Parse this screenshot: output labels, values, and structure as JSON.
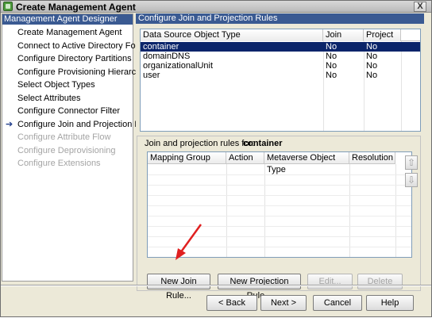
{
  "window": {
    "title": "Create Management Agent",
    "close_glyph": "X"
  },
  "left_panel": {
    "header": "Management Agent Designer",
    "current_marker": "➔",
    "items": [
      {
        "label": "Create Management Agent",
        "state": "enabled"
      },
      {
        "label": "Connect to Active Directory Forest",
        "state": "enabled"
      },
      {
        "label": "Configure Directory Partitions",
        "state": "enabled"
      },
      {
        "label": "Configure Provisioning Hierarchy",
        "state": "enabled"
      },
      {
        "label": "Select Object Types",
        "state": "enabled"
      },
      {
        "label": "Select Attributes",
        "state": "enabled"
      },
      {
        "label": "Configure Connector Filter",
        "state": "enabled"
      },
      {
        "label": "Configure Join and Projection Rules",
        "state": "current"
      },
      {
        "label": "Configure Attribute Flow",
        "state": "disabled"
      },
      {
        "label": "Configure Deprovisioning",
        "state": "disabled"
      },
      {
        "label": "Configure Extensions",
        "state": "disabled"
      }
    ]
  },
  "main": {
    "header": "Configure Join and Projection Rules",
    "object_table": {
      "columns": [
        "Data Source Object Type",
        "Join",
        "Project"
      ],
      "rows": [
        [
          "container",
          "No",
          "No"
        ],
        [
          "domainDNS",
          "No",
          "No"
        ],
        [
          "organizationalUnit",
          "No",
          "No"
        ],
        [
          "user",
          "No",
          "No"
        ]
      ],
      "selected_row": 0
    },
    "rules": {
      "label": "Join and projection rules for:",
      "object": "container",
      "columns": [
        "Mapping Group",
        "Action",
        "Metaverse Object Type",
        "Resolution"
      ],
      "move_up": "⇧",
      "move_down": "⇩",
      "buttons": {
        "new_join": "New Join Rule...",
        "new_projection": "New Projection Rule...",
        "edit": "Edit...",
        "delete": "Delete"
      }
    }
  },
  "footer": {
    "back": "< Back",
    "next": "Next >",
    "cancel": "Cancel",
    "help": "Help"
  },
  "colors": {
    "header_blue": "#3a5a92",
    "selection": "#0a246a",
    "annotation_arrow": "#e02020"
  }
}
